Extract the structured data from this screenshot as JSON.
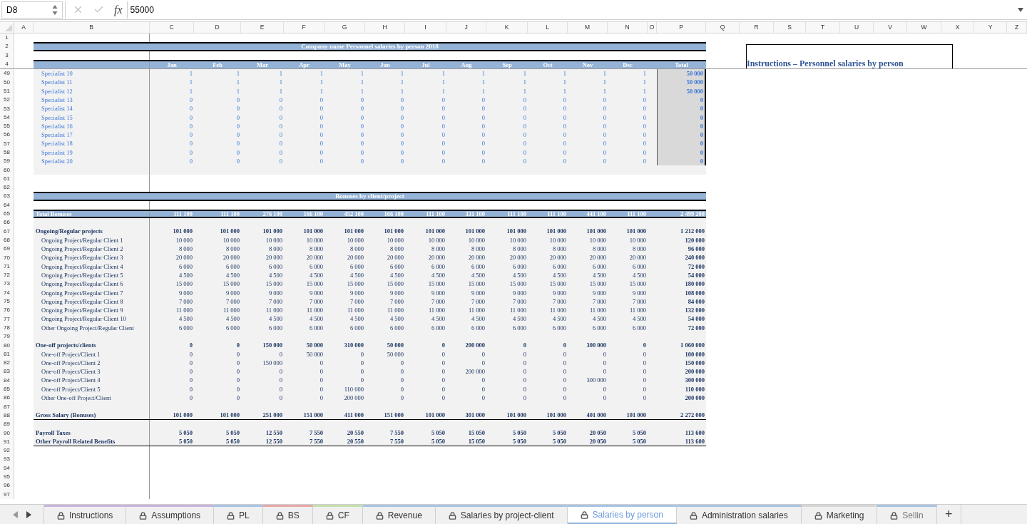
{
  "formula_bar": {
    "cell_ref": "D8",
    "fx_label": "fx",
    "formula": "55000"
  },
  "columns": [
    "A",
    "B",
    "C",
    "D",
    "E",
    "F",
    "G",
    "H",
    "I",
    "J",
    "K",
    "L",
    "M",
    "N",
    "O",
    "P",
    "Q",
    "R",
    "S",
    "T",
    "U",
    "V",
    "W",
    "X",
    "Y",
    "Z"
  ],
  "instructions_box": {
    "title": "Instructions – Personnel salaries by person"
  },
  "frozen_rows": [
    {
      "number": "1",
      "kind": "blank"
    },
    {
      "number": "2",
      "kind": "title",
      "title": "Company name Personnel salaries by person 2018"
    },
    {
      "number": "3",
      "kind": "blank"
    },
    {
      "number": "4",
      "kind": "months",
      "months": [
        "Jan",
        "Feb",
        "Mar",
        "Apr",
        "May",
        "Jun",
        "Jul",
        "Aug",
        "Sep",
        "Oct",
        "Nov",
        "Dec"
      ],
      "total": "Total"
    }
  ],
  "rows": [
    {
      "number": "49",
      "kind": "specialist",
      "label": "Specialist 10",
      "values": [
        "1",
        "1",
        "1",
        "1",
        "1",
        "1",
        "1",
        "1",
        "1",
        "1",
        "1",
        "1"
      ],
      "total": "50 000"
    },
    {
      "number": "50",
      "kind": "specialist",
      "label": "Specialist 11",
      "values": [
        "1",
        "1",
        "1",
        "1",
        "1",
        "1",
        "1",
        "1",
        "1",
        "1",
        "1",
        "1"
      ],
      "total": "50 000"
    },
    {
      "number": "51",
      "kind": "specialist",
      "label": "Specialist 12",
      "values": [
        "1",
        "1",
        "1",
        "1",
        "1",
        "1",
        "1",
        "1",
        "1",
        "1",
        "1",
        "1"
      ],
      "total": "50 000"
    },
    {
      "number": "52",
      "kind": "specialist",
      "label": "Specialist 13",
      "values": [
        "0",
        "0",
        "0",
        "0",
        "0",
        "0",
        "0",
        "0",
        "0",
        "0",
        "0",
        "0"
      ],
      "total": "0"
    },
    {
      "number": "53",
      "kind": "specialist",
      "label": "Specialist 14",
      "values": [
        "0",
        "0",
        "0",
        "0",
        "0",
        "0",
        "0",
        "0",
        "0",
        "0",
        "0",
        "0"
      ],
      "total": "0"
    },
    {
      "number": "54",
      "kind": "specialist",
      "label": "Specialist 15",
      "values": [
        "0",
        "0",
        "0",
        "0",
        "0",
        "0",
        "0",
        "0",
        "0",
        "0",
        "0",
        "0"
      ],
      "total": "0"
    },
    {
      "number": "55",
      "kind": "specialist",
      "label": "Specialist 16",
      "values": [
        "0",
        "0",
        "0",
        "0",
        "0",
        "0",
        "0",
        "0",
        "0",
        "0",
        "0",
        "0"
      ],
      "total": "0"
    },
    {
      "number": "56",
      "kind": "specialist",
      "label": "Specialist 17",
      "values": [
        "0",
        "0",
        "0",
        "0",
        "0",
        "0",
        "0",
        "0",
        "0",
        "0",
        "0",
        "0"
      ],
      "total": "0"
    },
    {
      "number": "57",
      "kind": "specialist",
      "label": "Specialist 18",
      "values": [
        "0",
        "0",
        "0",
        "0",
        "0",
        "0",
        "0",
        "0",
        "0",
        "0",
        "0",
        "0"
      ],
      "total": "0"
    },
    {
      "number": "58",
      "kind": "specialist",
      "label": "Specialist 19",
      "values": [
        "0",
        "0",
        "0",
        "0",
        "0",
        "0",
        "0",
        "0",
        "0",
        "0",
        "0",
        "0"
      ],
      "total": "0"
    },
    {
      "number": "59",
      "kind": "specialist",
      "label": "Specialist 20",
      "values": [
        "0",
        "0",
        "0",
        "0",
        "0",
        "0",
        "0",
        "0",
        "0",
        "0",
        "0",
        "0"
      ],
      "total": "0"
    },
    {
      "number": "60",
      "kind": "gap"
    },
    {
      "number": "61",
      "kind": "blank"
    },
    {
      "number": "62",
      "kind": "blank"
    },
    {
      "number": "63",
      "kind": "title",
      "title": "Bonuses by client/project"
    },
    {
      "number": "64",
      "kind": "blank"
    },
    {
      "number": "65",
      "kind": "band_total",
      "label": "Total Bonuses",
      "values": [
        "111 100",
        "111 100",
        "276 100",
        "166 100",
        "452 100",
        "166 100",
        "111 100",
        "331 100",
        "111 100",
        "111 100",
        "441 100",
        "111 100"
      ],
      "total": "2 499 200"
    },
    {
      "number": "66",
      "kind": "gap"
    },
    {
      "number": "67",
      "kind": "group",
      "label": "Ongoing/Regular projects",
      "values": [
        "101 000",
        "101 000",
        "101 000",
        "101 000",
        "101 000",
        "101 000",
        "101 000",
        "101 000",
        "101 000",
        "101 000",
        "101 000",
        "101 000"
      ],
      "total": "1 212 000"
    },
    {
      "number": "68",
      "kind": "item",
      "label": "Ongoing Project/Regular Client 1",
      "values": [
        "10 000",
        "10 000",
        "10 000",
        "10 000",
        "10 000",
        "10 000",
        "10 000",
        "10 000",
        "10 000",
        "10 000",
        "10 000",
        "10 000"
      ],
      "total": "120 000"
    },
    {
      "number": "69",
      "kind": "item",
      "label": "Ongoing Project/Regular Client 2",
      "values": [
        "8 000",
        "8 000",
        "8 000",
        "8 000",
        "8 000",
        "8 000",
        "8 000",
        "8 000",
        "8 000",
        "8 000",
        "8 000",
        "8 000"
      ],
      "total": "96 000"
    },
    {
      "number": "70",
      "kind": "item",
      "label": "Ongoing Project/Regular Client 3",
      "values": [
        "20 000",
        "20 000",
        "20 000",
        "20 000",
        "20 000",
        "20 000",
        "20 000",
        "20 000",
        "20 000",
        "20 000",
        "20 000",
        "20 000"
      ],
      "total": "240 000"
    },
    {
      "number": "71",
      "kind": "item",
      "label": "Ongoing Project/Regular Client 4",
      "values": [
        "6 000",
        "6 000",
        "6 000",
        "6 000",
        "6 000",
        "6 000",
        "6 000",
        "6 000",
        "6 000",
        "6 000",
        "6 000",
        "6 000"
      ],
      "total": "72 000"
    },
    {
      "number": "72",
      "kind": "item",
      "label": "Ongoing Project/Regular Client 5",
      "values": [
        "4 500",
        "4 500",
        "4 500",
        "4 500",
        "4 500",
        "4 500",
        "4 500",
        "4 500",
        "4 500",
        "4 500",
        "4 500",
        "4 500"
      ],
      "total": "54 000"
    },
    {
      "number": "73",
      "kind": "item",
      "label": "Ongoing Project/Regular Client 6",
      "values": [
        "15 000",
        "15 000",
        "15 000",
        "15 000",
        "15 000",
        "15 000",
        "15 000",
        "15 000",
        "15 000",
        "15 000",
        "15 000",
        "15 000"
      ],
      "total": "180 000"
    },
    {
      "number": "74",
      "kind": "item",
      "label": "Ongoing Project/Regular Client 7",
      "values": [
        "9 000",
        "9 000",
        "9 000",
        "9 000",
        "9 000",
        "9 000",
        "9 000",
        "9 000",
        "9 000",
        "9 000",
        "9 000",
        "9 000"
      ],
      "total": "108 000"
    },
    {
      "number": "75",
      "kind": "item",
      "label": "Ongoing Project/Regular Client 8",
      "values": [
        "7 000",
        "7 000",
        "7 000",
        "7 000",
        "7 000",
        "7 000",
        "7 000",
        "7 000",
        "7 000",
        "7 000",
        "7 000",
        "7 000"
      ],
      "total": "84 000"
    },
    {
      "number": "76",
      "kind": "item",
      "label": "Ongoing Project/Regular Client 9",
      "values": [
        "11 000",
        "11 000",
        "11 000",
        "11 000",
        "11 000",
        "11 000",
        "11 000",
        "11 000",
        "11 000",
        "11 000",
        "11 000",
        "11 000"
      ],
      "total": "132 000"
    },
    {
      "number": "77",
      "kind": "item",
      "label": "Ongoing Project/Regular Client 10",
      "values": [
        "4 500",
        "4 500",
        "4 500",
        "4 500",
        "4 500",
        "4 500",
        "4 500",
        "4 500",
        "4 500",
        "4 500",
        "4 500",
        "4 500"
      ],
      "total": "54 000"
    },
    {
      "number": "78",
      "kind": "item",
      "label": "Other Ongoing Project/Regular Client",
      "values": [
        "6 000",
        "6 000",
        "6 000",
        "6 000",
        "6 000",
        "6 000",
        "6 000",
        "6 000",
        "6 000",
        "6 000",
        "6 000",
        "6 000"
      ],
      "total": "72 000"
    },
    {
      "number": "79",
      "kind": "gap"
    },
    {
      "number": "80",
      "kind": "group",
      "label": "One-off projects/clients",
      "values": [
        "0",
        "0",
        "150 000",
        "50 000",
        "310 000",
        "50 000",
        "0",
        "200 000",
        "0",
        "0",
        "300 000",
        "0"
      ],
      "total": "1 060 000"
    },
    {
      "number": "81",
      "kind": "item",
      "label": "One-off Project/Client 1",
      "values": [
        "0",
        "0",
        "0",
        "50 000",
        "0",
        "50 000",
        "0",
        "0",
        "0",
        "0",
        "0",
        "0"
      ],
      "total": "100 000"
    },
    {
      "number": "82",
      "kind": "item",
      "label": "One-off Project/Client 2",
      "values": [
        "0",
        "0",
        "150 000",
        "0",
        "0",
        "0",
        "0",
        "0",
        "0",
        "0",
        "0",
        "0"
      ],
      "total": "150 000"
    },
    {
      "number": "83",
      "kind": "item",
      "label": "One-off Project/Client 3",
      "values": [
        "0",
        "0",
        "0",
        "0",
        "0",
        "0",
        "0",
        "200 000",
        "0",
        "0",
        "0",
        "0"
      ],
      "total": "200 000"
    },
    {
      "number": "84",
      "kind": "item",
      "label": "One-off Project/Client 4",
      "values": [
        "0",
        "0",
        "0",
        "0",
        "0",
        "0",
        "0",
        "0",
        "0",
        "0",
        "300 000",
        "0"
      ],
      "total": "300 000"
    },
    {
      "number": "85",
      "kind": "item",
      "label": "One-off Project/Client 5",
      "values": [
        "0",
        "0",
        "0",
        "0",
        "110 000",
        "0",
        "0",
        "0",
        "0",
        "0",
        "0",
        "0"
      ],
      "total": "110 000"
    },
    {
      "number": "86",
      "kind": "item",
      "label": "Other One-off Project/Client",
      "values": [
        "0",
        "0",
        "0",
        "0",
        "200 000",
        "0",
        "0",
        "0",
        "0",
        "0",
        "0",
        "0"
      ],
      "total": "200 000"
    },
    {
      "number": "87",
      "kind": "gap"
    },
    {
      "number": "88",
      "kind": "total",
      "rule_below": true,
      "label": "Gross Salary (Bonuses)",
      "values": [
        "101 000",
        "101 000",
        "251 000",
        "151 000",
        "411 000",
        "151 000",
        "101 000",
        "301 000",
        "101 000",
        "101 000",
        "401 000",
        "101 000"
      ],
      "total": "2 272 000"
    },
    {
      "number": "89",
      "kind": "gap"
    },
    {
      "number": "90",
      "kind": "total",
      "rule_below": false,
      "label": "Payroll Taxes",
      "values": [
        "5 050",
        "5 050",
        "12 550",
        "7 550",
        "20 550",
        "7 550",
        "5 050",
        "15 050",
        "5 050",
        "5 050",
        "20 050",
        "5 050"
      ],
      "total": "113 600"
    },
    {
      "number": "91",
      "kind": "total",
      "rule_below": true,
      "label": "Other Payroll Related Benefits",
      "values": [
        "5 050",
        "5 050",
        "12 550",
        "7 550",
        "20 550",
        "7 550",
        "5 050",
        "15 050",
        "5 050",
        "5 050",
        "20 050",
        "5 050"
      ],
      "total": "113 600"
    },
    {
      "number": "92",
      "kind": "blank"
    },
    {
      "number": "93",
      "kind": "blank"
    },
    {
      "number": "94",
      "kind": "blank"
    },
    {
      "number": "95",
      "kind": "blank"
    },
    {
      "number": "96",
      "kind": "blank"
    },
    {
      "number": "97",
      "kind": "blank"
    }
  ],
  "sheet_tabs": [
    {
      "label": "Instructions",
      "selected": false,
      "color": "#c8b4dc"
    },
    {
      "label": "Assumptions",
      "selected": false,
      "color": "#c8b4dc"
    },
    {
      "label": "PL",
      "selected": false,
      "color": "#a9c4e4"
    },
    {
      "label": "BS",
      "selected": false,
      "color": "#e8a9a9"
    },
    {
      "label": "CF",
      "selected": false,
      "color": "#c5e0ad"
    },
    {
      "label": "Revenue",
      "selected": false,
      "color": "#a9c4e4"
    },
    {
      "label": "Salaries by project-client",
      "selected": false,
      "color": "#a9c4e4"
    },
    {
      "label": "Salaries by person",
      "selected": true,
      "color": "#a9c4e4"
    },
    {
      "label": "Administration salaries",
      "selected": false,
      "color": "#a9c4e4"
    },
    {
      "label": "Marketing",
      "selected": false,
      "color": "#d6d6d6"
    },
    {
      "label": "Sellin",
      "selected": false,
      "color": "#a9c4e4"
    }
  ],
  "add_sheet": "+"
}
